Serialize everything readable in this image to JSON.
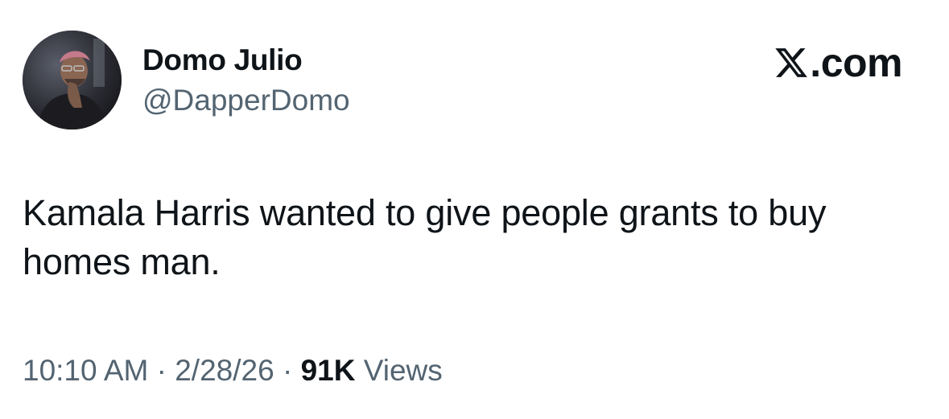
{
  "author": {
    "display_name": "Domo Julio",
    "handle": "@DapperDomo",
    "avatar_icon": "avatar-photo-man"
  },
  "brand": {
    "logo_icon": "x-logo-icon",
    "site_text": ".com"
  },
  "tweet": {
    "text": "Kamala Harris wanted to give people grants to buy homes man."
  },
  "meta": {
    "time": "10:10 AM",
    "separator_1": " · ",
    "date": "2/28/26",
    "separator_2": " · ",
    "views_count": "91K",
    "views_label": " Views"
  },
  "colors": {
    "text_primary": "#0f1419",
    "text_secondary": "#536471",
    "background": "#ffffff"
  }
}
